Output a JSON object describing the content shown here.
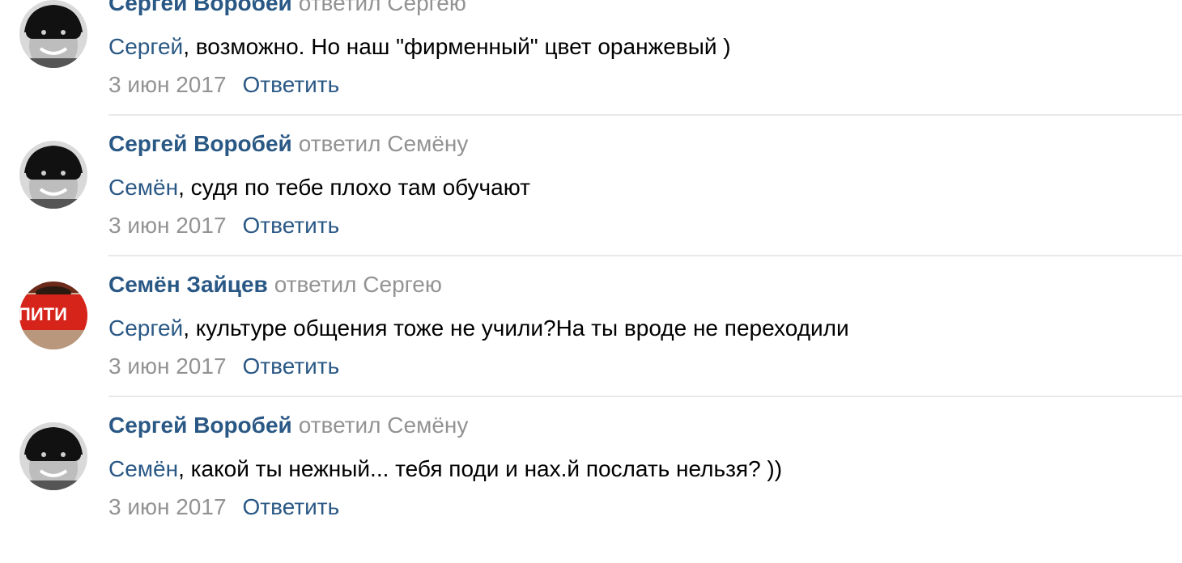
{
  "comments": [
    {
      "author": "Сергей Воробей",
      "replied": "ответил Сергею",
      "mention": "Сергей",
      "text": ", возможно. Но наш \"фирменный\" цвет оранжевый )",
      "date": "3 июн 2017",
      "reply": "Ответить",
      "avatar": "masked-man"
    },
    {
      "author": "Сергей Воробей",
      "replied": "ответил Семёну",
      "mention": "Семён",
      "text": ", судя по тебе плохо там обучают",
      "date": "3 июн 2017",
      "reply": "Ответить",
      "avatar": "masked-man"
    },
    {
      "author": "Семён Зайцев",
      "replied": "ответил Сергею",
      "mention": "Сергей",
      "text": ", культуре общения тоже не учили?На ты вроде не переходили",
      "date": "3 июн 2017",
      "reply": "Ответить",
      "avatar": "piti-logo",
      "avatar_text": "ПИТИ"
    },
    {
      "author": "Сергей Воробей",
      "replied": "ответил Семёну",
      "mention": "Семён",
      "text": ", какой ты нежный... тебя поди и нах.й послать нельзя? ))",
      "date": "3 июн 2017",
      "reply": "Ответить",
      "avatar": "masked-man"
    }
  ],
  "colors": {
    "link": "#2a5885",
    "muted": "#939393",
    "text": "#000000",
    "divider": "#e7e8ec"
  }
}
